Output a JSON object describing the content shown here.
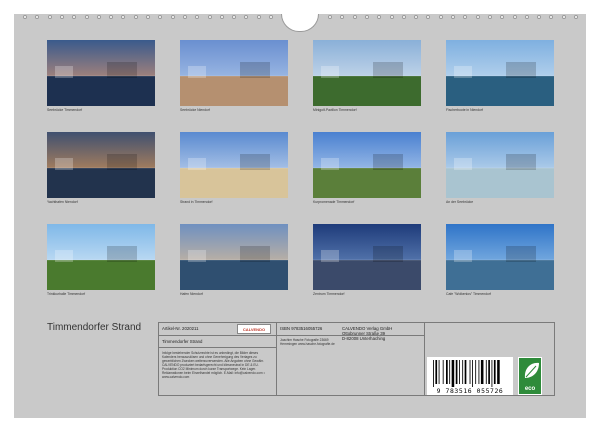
{
  "calendar": {
    "title": "Timmendorfer Strand",
    "photos": [
      {
        "caption": "Seebrücke Timmendorf"
      },
      {
        "caption": "Seebrücke Niendorf"
      },
      {
        "caption": "Minigolf-Pavillon Timmendorf"
      },
      {
        "caption": "Fischerboote in Niendorf"
      },
      {
        "caption": "Yachthafen Niendorf"
      },
      {
        "caption": "Strand in Timmendorf"
      },
      {
        "caption": "Kurpromenade Timmendorf"
      },
      {
        "caption": "An der Seebrücke"
      },
      {
        "caption": "Trinkkurhalle Timmendorf"
      },
      {
        "caption": "Hafen Niendorf"
      },
      {
        "caption": "Zentrum Timmendorf"
      },
      {
        "caption": "Cafe \"Wolkenlos\" Timmendorf"
      }
    ]
  },
  "info": {
    "article": "Artikel-Nr. 2020211",
    "logo": "CALVENDO",
    "subtitle": "Timmendorfer Strand",
    "description": "Infolge bestehender Schutzrechte ist es unbedingt, die Bilder dieses Kalenders herauszulösen und ohne Genehmigung des Verlages zu gewerblichen Zwecken weiterzuverwenden. Alle Angaben ohne Gewähr. CALVENDO produziert bedarfsgerecht und klimaneutral in DE & EU. Produktion CO2 Minimum durch kurze Transportwege. Kein Lager. Reklamationen beim Einzelhandel möglich. E-Mail: info@calvendo.com • www.calvendo.com",
    "isbn": "ISBN 9783516055726",
    "author": "Joachim Hasche Fotografie 23669 Hemmingen www.hasche-fotografie.de",
    "publisher": [
      "CALVENDO Verlag GmbH",
      "Ottobrunner Straße 39",
      "D-82008 Unterhaching"
    ],
    "barcode": "9 783516 055726",
    "eco_label": "eco"
  }
}
